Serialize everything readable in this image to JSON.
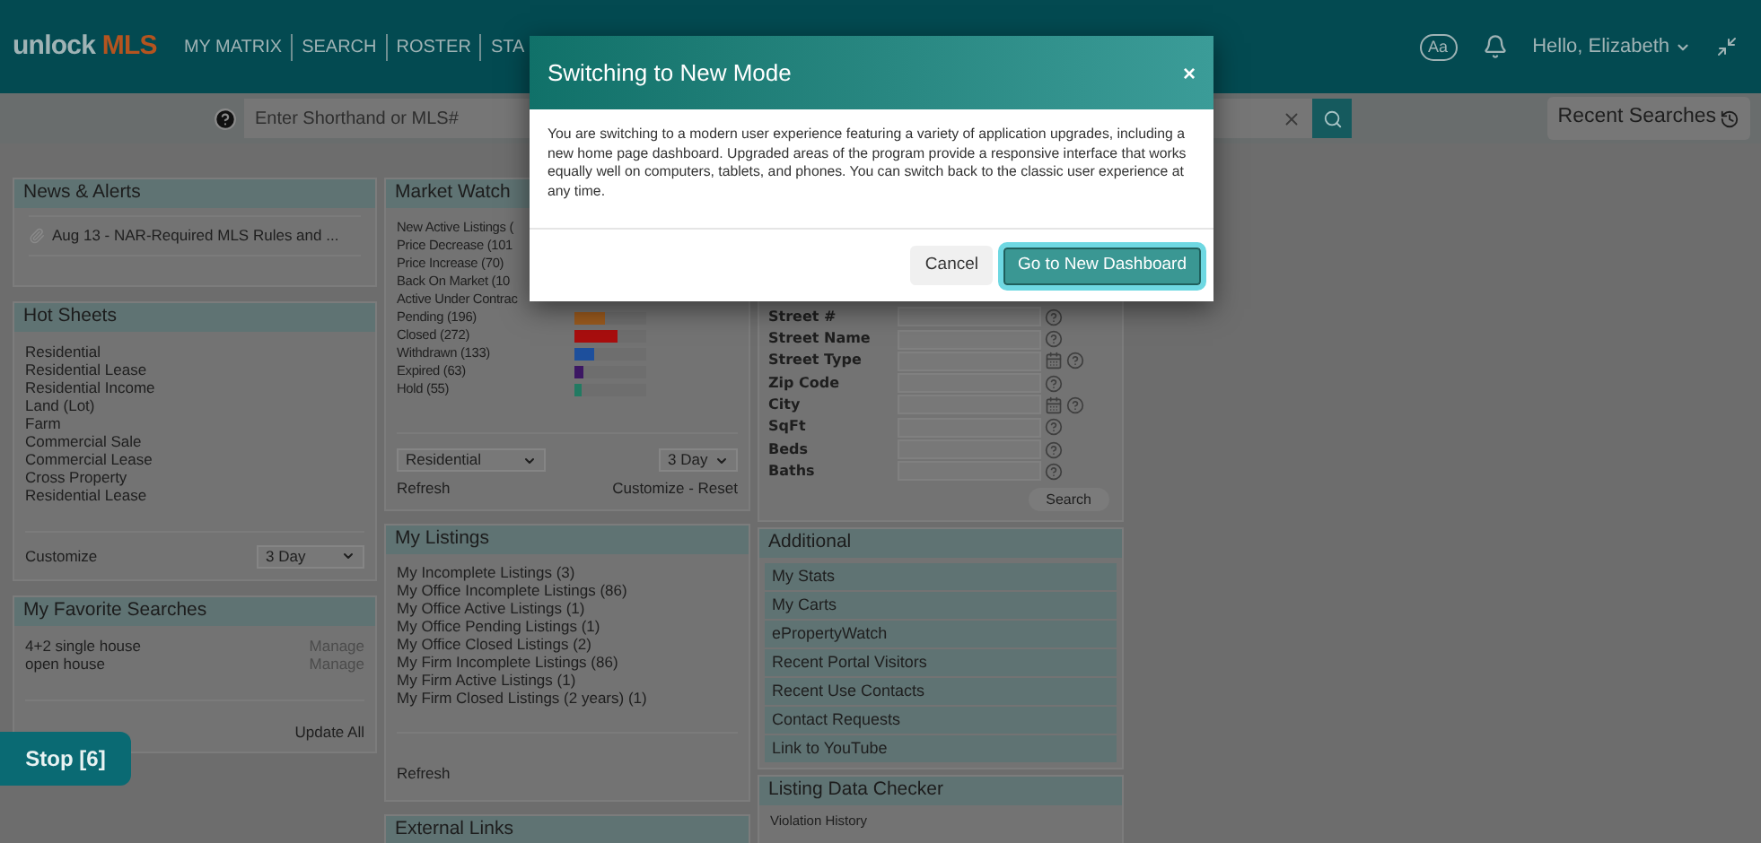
{
  "header": {
    "logo_left": "unlock",
    "logo_right": "MLS",
    "nav": [
      "MY MATRIX",
      "SEARCH",
      "ROSTER",
      "STA"
    ],
    "font_button": "Aa",
    "greeting": "Hello, Elizabeth"
  },
  "search_bar": {
    "placeholder": "Enter Shorthand or MLS#",
    "recent_button": "Recent Searches"
  },
  "news": {
    "title": "News & Alerts",
    "items": [
      "Aug 13 - NAR-Required MLS Rules and ..."
    ]
  },
  "hot_sheets": {
    "title": "Hot Sheets",
    "items": [
      "Residential",
      "Residential Lease",
      "Residential Income",
      "Land (Lot)",
      "Farm",
      "Commercial Sale",
      "Commercial Lease",
      "Cross Property",
      "Residential Lease"
    ],
    "customize": "Customize",
    "period": "3 Day"
  },
  "favorites": {
    "title": "My Favorite Searches",
    "items": [
      {
        "name": "4+2 single house",
        "action": "Manage"
      },
      {
        "name": "open house",
        "action": "Manage"
      }
    ],
    "update_all": "Update All"
  },
  "market_watch": {
    "title": "Market Watch",
    "items": [
      {
        "label": "New Active Listings ("
      },
      {
        "label": "Price Decrease (101"
      },
      {
        "label": "Price Increase (70)"
      },
      {
        "label": "Back On Market (10"
      },
      {
        "label": "Active Under Contrac"
      },
      {
        "label": "Pending (196)",
        "color": "#9a5a1e",
        "level": 0.42
      },
      {
        "label": "Closed (272)",
        "color": "#a80e0e",
        "level": 0.6
      },
      {
        "label": "Withdrawn (133)",
        "color": "#1d4f9c",
        "level": 0.28
      },
      {
        "label": "Expired (63)",
        "color": "#3c1763",
        "level": 0.12
      },
      {
        "label": "Hold (55)",
        "color": "#227a62",
        "level": 0.1
      }
    ],
    "type_select": "Residential",
    "period": "3 Day",
    "refresh": "Refresh",
    "links": "Customize - Reset"
  },
  "my_listings": {
    "title": "My Listings",
    "items": [
      "My Incomplete Listings (3)",
      "My Office Incomplete Listings (86)",
      "My Office Active Listings (1)",
      "My Office Pending Listings (1)",
      "My Office Closed Listings (2)",
      "My Firm Incomplete Listings (86)",
      "My Firm Active Listings (1)",
      "My Firm Closed Listings (2 years) (1)"
    ],
    "refresh": "Refresh"
  },
  "external_links": {
    "title": "External Links"
  },
  "search_form": {
    "fields": [
      {
        "label": "Street #",
        "kind": "text"
      },
      {
        "label": "Street Name",
        "kind": "text"
      },
      {
        "label": "Street Type",
        "kind": "lookup"
      },
      {
        "label": "Zip Code",
        "kind": "text"
      },
      {
        "label": "City",
        "kind": "lookup"
      },
      {
        "label": "SqFt",
        "kind": "text"
      },
      {
        "label": "Beds",
        "kind": "text"
      },
      {
        "label": "Baths",
        "kind": "text"
      }
    ],
    "button": "Search"
  },
  "additional": {
    "title": "Additional",
    "items": [
      "My Stats",
      "My Carts",
      "ePropertyWatch",
      "Recent Portal Visitors",
      "Recent Use Contacts",
      "Contact Requests",
      "Link to YouTube"
    ]
  },
  "listing_checker": {
    "title": "Listing Data Checker",
    "items": [
      "Violation History"
    ]
  },
  "stop_button": "Stop [6]",
  "dialog": {
    "title": "Switching to New Mode",
    "close": "×",
    "body": "You are switching to a modern user experience featuring a variety of application upgrades, including a new home page dashboard. Upgraded areas of the program provide a responsive interface that works equally well on computers, tablets, and phones. You can switch back to the classic user experience at any time.",
    "cancel": "Cancel",
    "confirm": "Go to New Dashboard"
  }
}
